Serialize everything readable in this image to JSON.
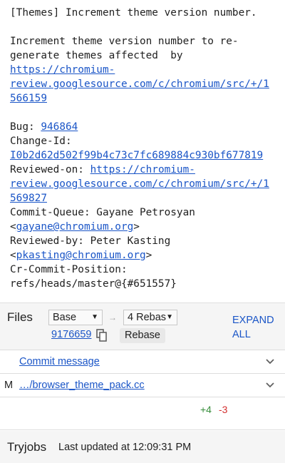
{
  "commit": {
    "subject": "[Themes] Increment theme version number.",
    "body_line1": "Increment theme version number to re-",
    "body_line2": "generate themes affected  by",
    "review_link_1a": "https://chromium-",
    "review_link_1b": "review.googlesource.com/c/chromium/src/+/1",
    "review_link_1c": "566159",
    "bug_label": "Bug: ",
    "bug_number": "946864",
    "change_id_label": "Change-Id:",
    "change_id": "I0b2d62d502f99b4c73c7fc689884c930bf677819",
    "reviewed_on_label": "Reviewed-on: ",
    "review_link_2a": "https://chromium-",
    "review_link_2b": "review.googlesource.com/c/chromium/src/+/1",
    "review_link_2c": "569827",
    "commit_queue": "Commit-Queue: Gayane Petrosyan",
    "cq_email_open": "<",
    "cq_email": "gayane@chromium.org",
    "cq_email_close": ">",
    "reviewed_by": "Reviewed-by: Peter Kasting",
    "rb_email_open": "<",
    "rb_email": "pkasting@chromium.org",
    "rb_email_close": ">",
    "cr_commit_position_label": "Cr-Commit-Position:",
    "cr_commit_position": "refs/heads/master@{#651557}"
  },
  "files": {
    "title": "Files",
    "base_select": "Base",
    "rebase_select": "4 Rebas",
    "arrow": "→",
    "patchset_id": "9176659",
    "rebase_button": "Rebase",
    "expand_all": "EXPAND ALL",
    "commit_message_row": "Commit message",
    "file_status": "M",
    "file_name": "…/browser_theme_pack.cc",
    "added": "+4",
    "removed": "-3"
  },
  "tryjobs": {
    "title": "Tryjobs",
    "updated": "Last updated at 12:09:31 PM"
  },
  "colors": {
    "link": "#1a55c7",
    "added": "#388e3c",
    "removed": "#d32f2f",
    "section_bg": "#f5f5f5"
  },
  "icons": {
    "copy": "copy-icon",
    "chevron": "chevron-down-icon",
    "dropdown": "dropdown-caret-icon"
  }
}
